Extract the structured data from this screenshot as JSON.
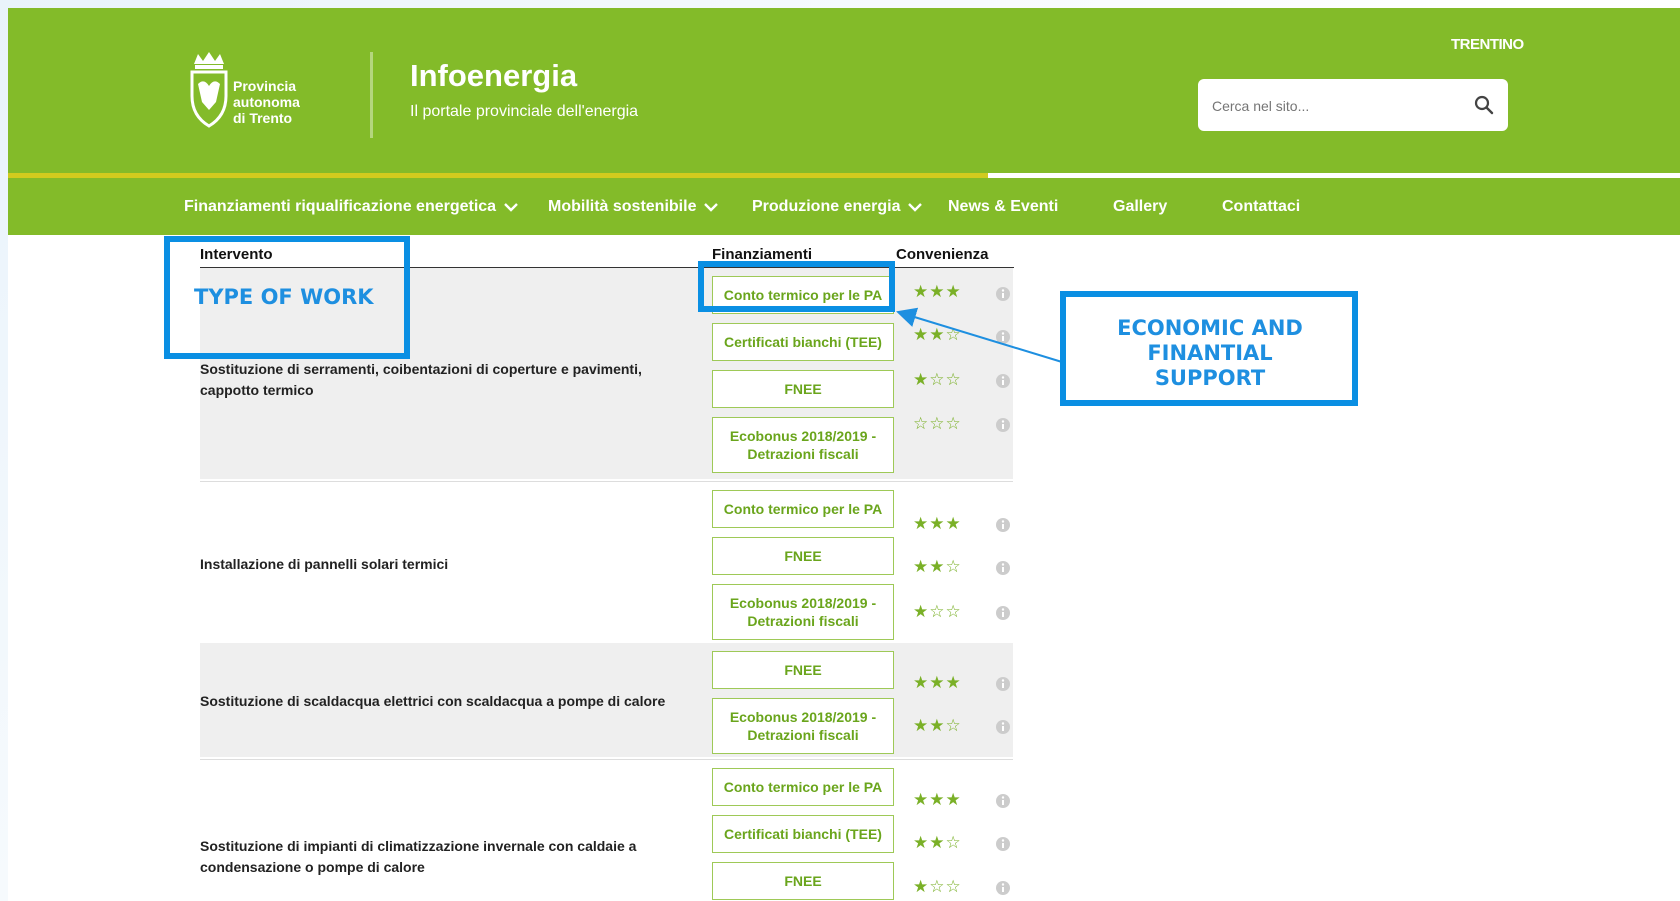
{
  "header": {
    "brand_lines": [
      "Provincia",
      "autonoma",
      "di Trento"
    ],
    "site_title": "Infoenergia",
    "site_subtitle": "Il portale provinciale dell'energia",
    "region_logo": "TRENTINO",
    "search": {
      "placeholder": "Cerca nel sito..."
    },
    "colors": {
      "primary_green": "#83bb29",
      "accent_yellow": "#d1cb1e"
    }
  },
  "nav": {
    "items": [
      {
        "label": "Finanziamenti riqualificazione energetica",
        "has_dropdown": true
      },
      {
        "label": "Mobilità sostenibile",
        "has_dropdown": true
      },
      {
        "label": "Produzione energia",
        "has_dropdown": true
      },
      {
        "label": "News & Eventi",
        "has_dropdown": false
      },
      {
        "label": "Gallery",
        "has_dropdown": false
      },
      {
        "label": "Contattaci",
        "has_dropdown": false
      }
    ]
  },
  "table": {
    "headers": {
      "intervento": "Intervento",
      "finanziamenti": "Finanziamenti",
      "convenienza": "Convenienza"
    },
    "groups": [
      {
        "label": "Sostituzione di serramenti, coibentazioni di coperture e pavimenti, cappotto termico",
        "rows": [
          {
            "financing": "Conto termico per le PA",
            "stars": 3
          },
          {
            "financing": "Certificati bianchi (TEE)",
            "stars": 2
          },
          {
            "financing": "FNEE",
            "stars": 1
          },
          {
            "financing": "Ecobonus 2018/2019 - Detrazioni fiscali",
            "stars": 0
          }
        ]
      },
      {
        "label": "Installazione di pannelli solari termici",
        "rows": [
          {
            "financing": "Conto termico per le PA",
            "stars": 3
          },
          {
            "financing": "FNEE",
            "stars": 2
          },
          {
            "financing": "Ecobonus 2018/2019 - Detrazioni fiscali",
            "stars": 1
          }
        ]
      },
      {
        "label": "Sostituzione di scaldacqua elettrici con scaldacqua a pompe di calore",
        "rows": [
          {
            "financing": "FNEE",
            "stars": 3
          },
          {
            "financing": "Ecobonus 2018/2019 - Detrazioni fiscali",
            "stars": 2
          }
        ]
      },
      {
        "label": "Sostituzione di impianti di climatizzazione invernale con caldaie a condensazione o pompe di calore",
        "rows": [
          {
            "financing": "Conto termico per le PA",
            "stars": 3
          },
          {
            "financing": "Certificati bianchi (TEE)",
            "stars": 2
          },
          {
            "financing": "FNEE",
            "stars": 1
          }
        ]
      }
    ]
  },
  "annotations": {
    "type_of_work": "TYPE OF WORK",
    "economic_support": "ECONOMIC AND FINANTIAL SUPPORT",
    "color": "#0a8fe3"
  }
}
